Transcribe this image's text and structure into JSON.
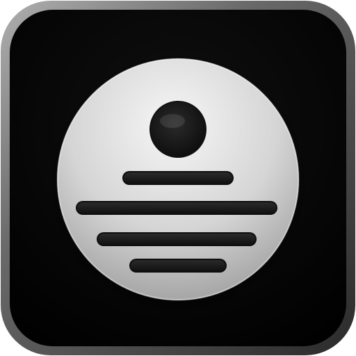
{
  "app_icon": {
    "icon_name": "podcast-list-icon",
    "colors": {
      "frame_light": "#9a9a9a",
      "frame_dark": "#2b2b2b",
      "tile_dark": "#0a0a0a",
      "disc_light": "#f2f2f2",
      "disc_mid": "#c9c9c9",
      "disc_dark": "#8f8f8f",
      "mark_dark": "#2a2a2a"
    },
    "lines": [
      {
        "name": "line-1"
      },
      {
        "name": "line-2"
      },
      {
        "name": "line-3"
      },
      {
        "name": "line-4"
      }
    ]
  }
}
